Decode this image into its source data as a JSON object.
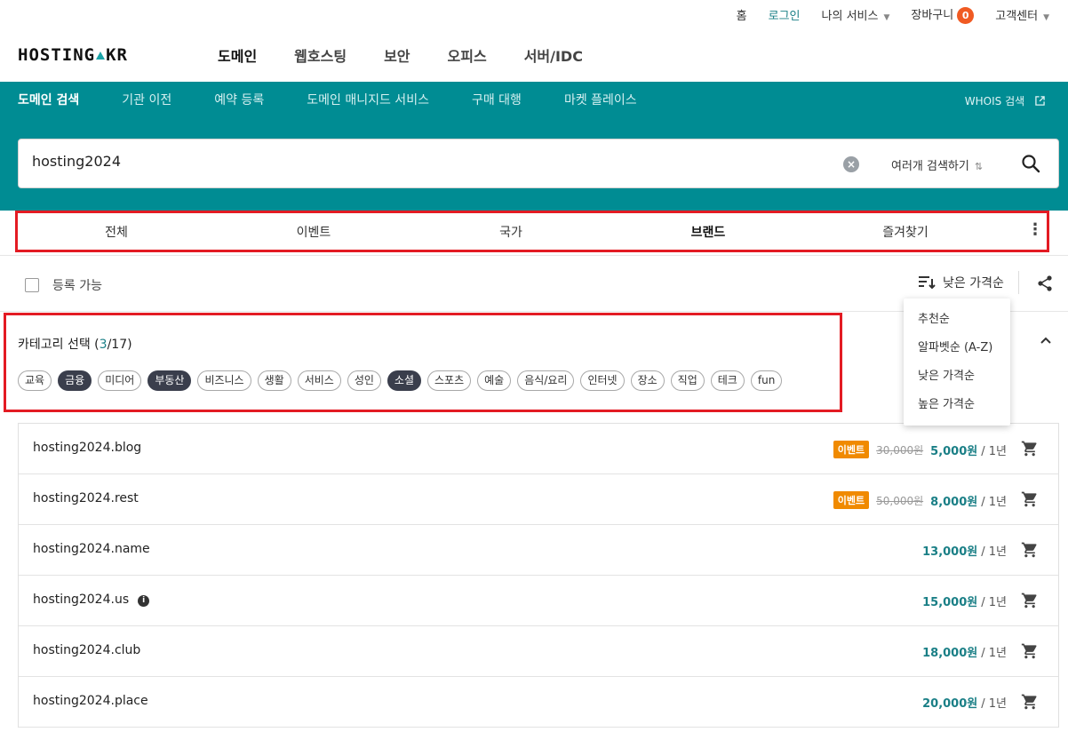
{
  "util_nav": {
    "home": "홈",
    "login": "로그인",
    "my_services": "나의 서비스",
    "cart": "장바구니",
    "cart_count": "0",
    "support": "고객센터"
  },
  "logo": {
    "left": "HOSTING",
    "right": "KR"
  },
  "gnb": [
    "도메인",
    "웹호스팅",
    "보안",
    "오피스",
    "서버/IDC"
  ],
  "subnav": {
    "items": [
      "도메인 검색",
      "기관 이전",
      "예약 등록",
      "도메인 매니지드 서비스",
      "구매 대행",
      "마켓 플레이스"
    ],
    "whois": "WHOIS 검색"
  },
  "search": {
    "value": "hosting2024",
    "multi_label": "여러개 검색하기"
  },
  "tabs": [
    "전체",
    "이벤트",
    "국가",
    "브랜드",
    "즐겨찾기"
  ],
  "options": {
    "available_label": "등록 가능",
    "sort_label": "낮은 가격순"
  },
  "sort_menu": [
    "추천순",
    "알파벳순 (A-Z)",
    "낮은 가격순",
    "높은 가격순"
  ],
  "category": {
    "title": "카테고리 선택 (",
    "selected": "3",
    "total": "/17)",
    "chips": [
      {
        "label": "교육",
        "on": false
      },
      {
        "label": "금융",
        "on": true
      },
      {
        "label": "미디어",
        "on": false
      },
      {
        "label": "부동산",
        "on": true
      },
      {
        "label": "비즈니스",
        "on": false
      },
      {
        "label": "생활",
        "on": false
      },
      {
        "label": "서비스",
        "on": false
      },
      {
        "label": "성인",
        "on": false
      },
      {
        "label": "소셜",
        "on": true
      },
      {
        "label": "스포츠",
        "on": false
      },
      {
        "label": "예술",
        "on": false
      },
      {
        "label": "음식/요리",
        "on": false
      },
      {
        "label": "인터넷",
        "on": false
      },
      {
        "label": "장소",
        "on": false
      },
      {
        "label": "직업",
        "on": false
      },
      {
        "label": "테크",
        "on": false
      },
      {
        "label": "fun",
        "on": false
      }
    ]
  },
  "results": [
    {
      "domain": "hosting2024.blog",
      "badge": "이벤트",
      "old_price": "30,000원",
      "price": "5,000원",
      "period": "/ 1년",
      "info": false
    },
    {
      "domain": "hosting2024.rest",
      "badge": "이벤트",
      "old_price": "50,000원",
      "price": "8,000원",
      "period": "/ 1년",
      "info": false
    },
    {
      "domain": "hosting2024.name",
      "badge": "",
      "old_price": "",
      "price": "13,000원",
      "period": "/ 1년",
      "info": false
    },
    {
      "domain": "hosting2024.us",
      "badge": "",
      "old_price": "",
      "price": "15,000원",
      "period": "/ 1년",
      "info": true
    },
    {
      "domain": "hosting2024.club",
      "badge": "",
      "old_price": "",
      "price": "18,000원",
      "period": "/ 1년",
      "info": false
    },
    {
      "domain": "hosting2024.place",
      "badge": "",
      "old_price": "",
      "price": "20,000원",
      "period": "/ 1년",
      "info": false
    }
  ]
}
